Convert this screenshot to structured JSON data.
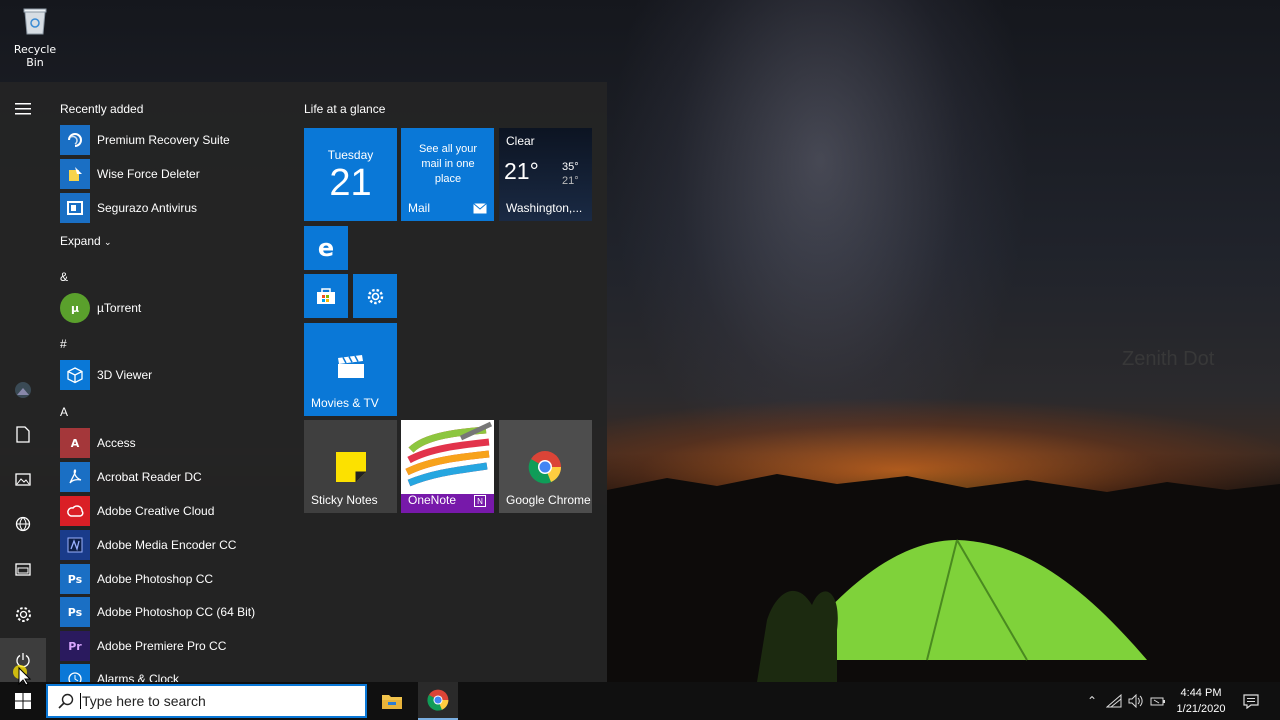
{
  "desktop": {
    "recycle_bin_label": "Recycle Bin",
    "watermark": "Zenith Dot"
  },
  "start_menu": {
    "recently_added_header": "Recently added",
    "recently_added": [
      {
        "label": "Premium Recovery Suite",
        "icon": "recovery-icon",
        "color": "#1a6fc4"
      },
      {
        "label": "Wise Force Deleter",
        "icon": "deleter-icon",
        "color": "#1a6fc4"
      },
      {
        "label": "Segurazo Antivirus",
        "icon": "antivirus-icon",
        "color": "#1a6fc4"
      }
    ],
    "expand_label": "Expand",
    "sections": [
      {
        "header": "&",
        "apps": [
          {
            "label": "µTorrent",
            "icon": "utorrent-icon",
            "color": "#5aa02c"
          }
        ]
      },
      {
        "header": "#",
        "apps": [
          {
            "label": "3D Viewer",
            "icon": "cube-icon",
            "color": "#0a78d7"
          }
        ]
      },
      {
        "header": "A",
        "apps": [
          {
            "label": "Access",
            "icon": "access-icon",
            "glyph": "A",
            "color": "#a4373a"
          },
          {
            "label": "Acrobat Reader DC",
            "icon": "acrobat-icon",
            "color": "#1a6fc4"
          },
          {
            "label": "Adobe Creative Cloud",
            "icon": "creative-cloud-icon",
            "color": "#da1f26"
          },
          {
            "label": "Adobe Media Encoder CC",
            "icon": "media-encoder-icon",
            "color": "#1a3b8a"
          },
          {
            "label": "Adobe Photoshop CC",
            "icon": "photoshop-icon",
            "glyph": "Ps",
            "color": "#1a6fc4"
          },
          {
            "label": "Adobe Photoshop CC (64 Bit)",
            "icon": "photoshop-icon",
            "glyph": "Ps",
            "color": "#1a6fc4"
          },
          {
            "label": "Adobe Premiere Pro CC",
            "icon": "premiere-icon",
            "glyph": "Pr",
            "color": "#2a1a5e"
          },
          {
            "label": "Alarms & Clock",
            "icon": "alarm-icon",
            "color": "#0a78d7"
          }
        ]
      }
    ],
    "life_header": "Life at a glance",
    "calendar_tile": {
      "day": "Tuesday",
      "date": "21"
    },
    "mail_tile": {
      "text": "See all your mail in one place",
      "label": "Mail"
    },
    "weather_tile": {
      "condition": "Clear",
      "temp": "21°",
      "high": "35°",
      "low": "21°",
      "location": "Washington,..."
    },
    "movies_tile": {
      "label": "Movies & TV"
    },
    "sticky_tile": {
      "label": "Sticky Notes"
    },
    "onenote_tile": {
      "label": "OneNote"
    },
    "chrome_tile": {
      "label": "Google Chrome"
    }
  },
  "taskbar": {
    "search_placeholder": "Type here to search",
    "time": "4:44 PM",
    "date": "1/21/2020"
  },
  "colors": {
    "accent": "#0a78d7",
    "start_bg": "#242424",
    "taskbar_bg": "#101010"
  }
}
